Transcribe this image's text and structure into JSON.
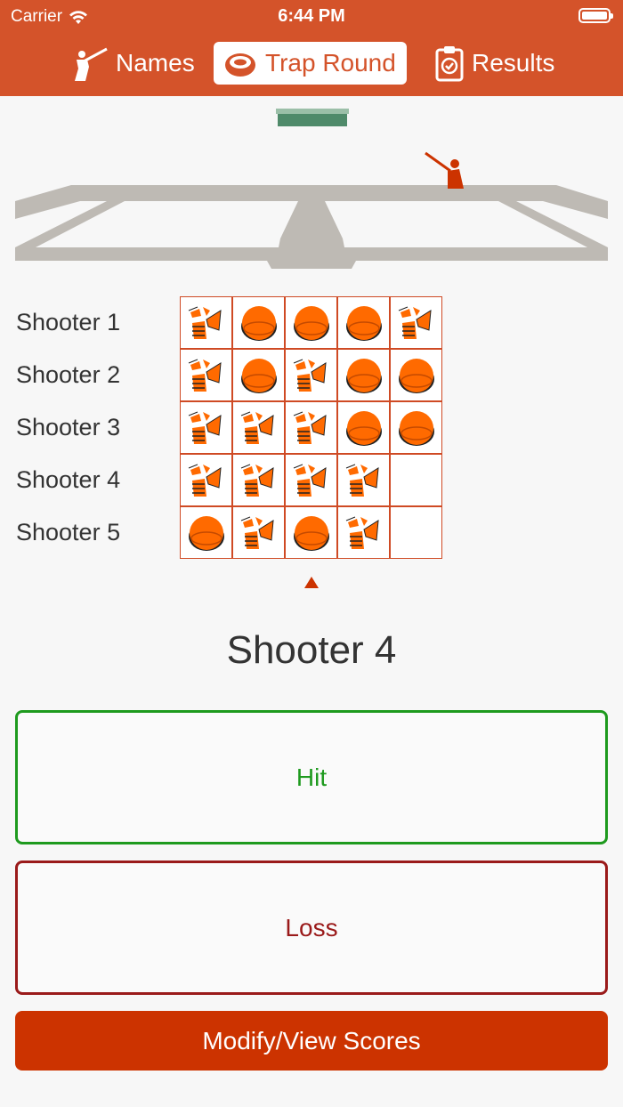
{
  "status_bar": {
    "carrier": "Carrier",
    "time": "6:44 PM"
  },
  "tabs": [
    {
      "label": "Names",
      "icon": "shooter-icon",
      "active": false
    },
    {
      "label": "Trap Round",
      "icon": "clay-target-icon",
      "active": true
    },
    {
      "label": "Results",
      "icon": "clipboard-check-icon",
      "active": false
    }
  ],
  "shooters": [
    {
      "label": "Shooter 1",
      "shots": [
        "broken",
        "target",
        "target",
        "target",
        "broken"
      ]
    },
    {
      "label": "Shooter 2",
      "shots": [
        "broken",
        "target",
        "broken",
        "target",
        "target"
      ]
    },
    {
      "label": "Shooter 3",
      "shots": [
        "broken",
        "broken",
        "broken",
        "target",
        "target"
      ]
    },
    {
      "label": "Shooter 4",
      "shots": [
        "broken",
        "broken",
        "broken",
        "broken",
        "empty"
      ]
    },
    {
      "label": "Shooter 5",
      "shots": [
        "target",
        "broken",
        "target",
        "broken",
        "empty"
      ]
    }
  ],
  "current_shooter": "Shooter 4",
  "buttons": {
    "hit": "Hit",
    "loss": "Loss",
    "modify": "Modify/View Scores"
  },
  "colors": {
    "header": "#d4532a",
    "hit": "#1e9a1e",
    "loss": "#9a1a1a",
    "modify": "#cc3300",
    "target": "#ff6a00"
  }
}
